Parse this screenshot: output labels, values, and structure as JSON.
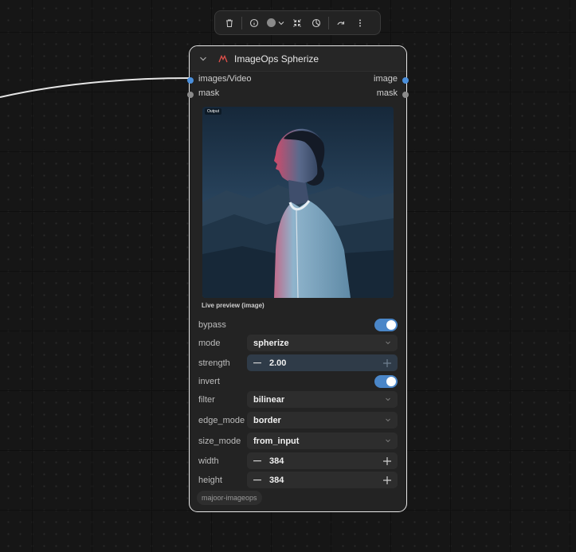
{
  "toolbar": {
    "buttons": [
      "delete-icon",
      "info-icon",
      "color-picker",
      "fit-icon",
      "pie-icon",
      "redo-icon",
      "more-icon"
    ],
    "color_swatch": "#8a8a8a"
  },
  "node": {
    "title": "ImageOps Spherize",
    "inputs": [
      {
        "label": "images/Video",
        "color": "#4a8fdc"
      },
      {
        "label": "mask",
        "color": "#8a8a8a"
      }
    ],
    "outputs": [
      {
        "label": "image",
        "color": "#4a8fdc"
      },
      {
        "label": "mask",
        "color": "#8a8a8a"
      }
    ],
    "preview": {
      "badge": "Output",
      "caption": "Live preview (image)"
    },
    "widgets": {
      "bypass": {
        "label": "bypass",
        "on": true
      },
      "mode": {
        "label": "mode",
        "value": "spherize"
      },
      "strength": {
        "label": "strength",
        "value": "2.00"
      },
      "invert": {
        "label": "invert",
        "on": true
      },
      "filter": {
        "label": "filter",
        "value": "bilinear"
      },
      "edge_mode": {
        "label": "edge_mode",
        "value": "border"
      },
      "size_mode": {
        "label": "size_mode",
        "value": "from_input"
      },
      "width": {
        "label": "width",
        "value": "384"
      },
      "height": {
        "label": "height",
        "value": "384"
      }
    },
    "tag": "majoor-imageops"
  },
  "colors": {
    "accent": "#4a86c8",
    "node_border": "#e8e8e8",
    "title_icon": "#e0504a"
  }
}
